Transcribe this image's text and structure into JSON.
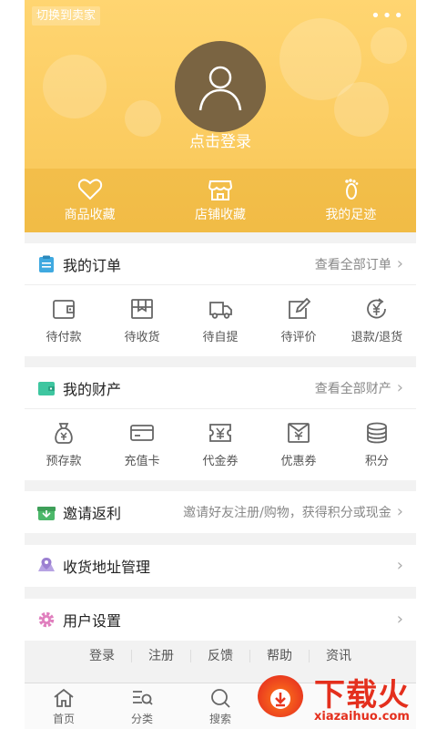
{
  "header": {
    "switch_label": "切换到卖家",
    "more_label": "•••",
    "login_text": "点击登录",
    "quick": [
      {
        "label": "商品收藏",
        "icon": "heart-icon"
      },
      {
        "label": "店铺收藏",
        "icon": "store-icon"
      },
      {
        "label": "我的足迹",
        "icon": "footprint-icon"
      }
    ]
  },
  "orders": {
    "title": "我的订单",
    "more": "查看全部订单",
    "icon": "clipboard-icon",
    "items": [
      {
        "label": "待付款",
        "icon": "wallet-icon"
      },
      {
        "label": "待收货",
        "icon": "box-icon"
      },
      {
        "label": "待自提",
        "icon": "truck-icon"
      },
      {
        "label": "待评价",
        "icon": "edit-icon"
      },
      {
        "label": "退款/退货",
        "icon": "refund-icon"
      }
    ]
  },
  "assets": {
    "title": "我的财产",
    "more": "查看全部财产",
    "icon": "wallet-green-icon",
    "items": [
      {
        "label": "预存款",
        "icon": "money-bag-icon"
      },
      {
        "label": "充值卡",
        "icon": "card-icon"
      },
      {
        "label": "代金券",
        "icon": "voucher-icon"
      },
      {
        "label": "优惠券",
        "icon": "coupon-icon"
      },
      {
        "label": "积分",
        "icon": "coins-icon"
      }
    ]
  },
  "invite": {
    "title": "邀请返利",
    "desc": "邀请好友注册/购物，获得积分或现金",
    "icon": "gift-icon"
  },
  "address": {
    "title": "收货地址管理",
    "icon": "map-pin-icon"
  },
  "settings": {
    "title": "用户设置",
    "icon": "gear-icon"
  },
  "chevron": "›",
  "footer": {
    "links": [
      "登录",
      "注册",
      "反馈",
      "帮助",
      "资讯"
    ]
  },
  "tabs": [
    {
      "label": "首页",
      "icon": "home-icon"
    },
    {
      "label": "分类",
      "icon": "category-icon"
    },
    {
      "label": "搜索",
      "icon": "search-icon"
    }
  ],
  "watermark": {
    "title": "下载火",
    "url": "xiazaihuo.com"
  },
  "colors": {
    "header": "#f8c656",
    "orders_icon": "#3fa9e0",
    "assets_icon": "#3ec6a0",
    "invite_icon": "#4cb86a",
    "address_icon": "#9b7fd1",
    "settings_icon": "#e07fbe",
    "watermark": "#e42f1d"
  }
}
